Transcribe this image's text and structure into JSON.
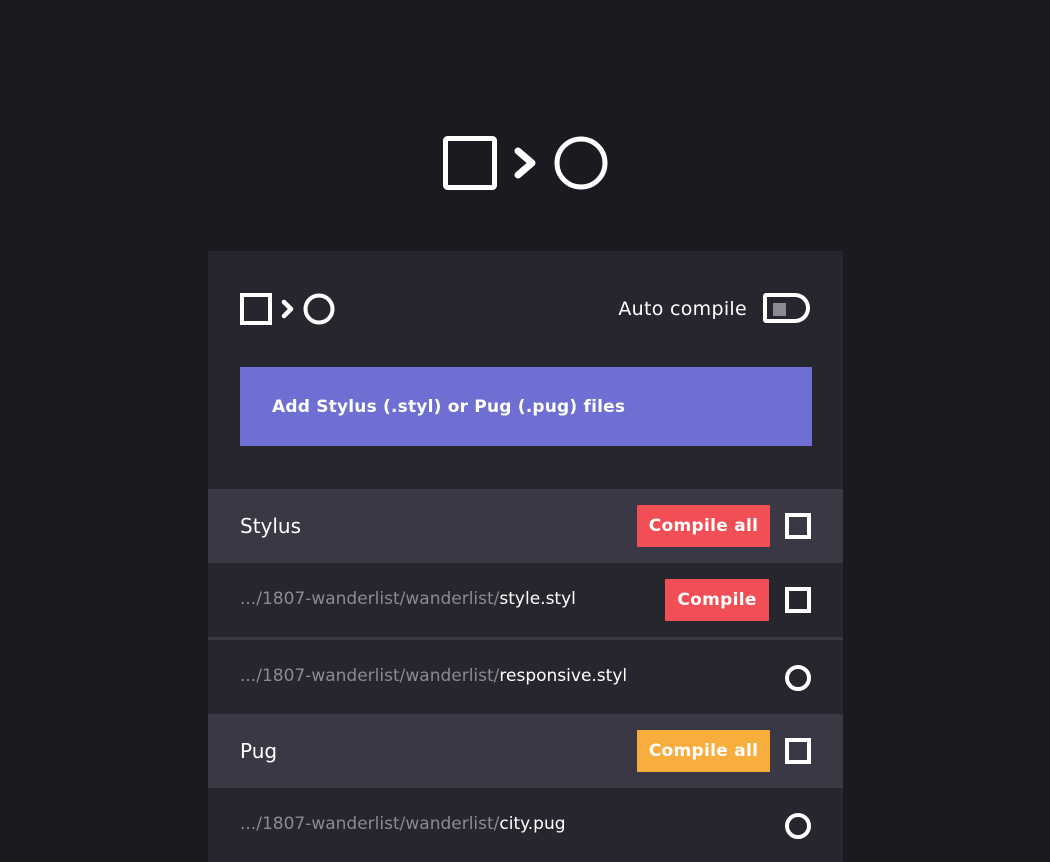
{
  "header": {
    "auto_compile_label": "Auto compile"
  },
  "add_files": {
    "label": "Add Stylus (.styl) or Pug (.pug) files"
  },
  "groups": [
    {
      "title": "Stylus",
      "action_label": "Compile all",
      "action_color": "#f14f55",
      "files": [
        {
          "dir": ".../1807-wanderlist/wanderlist/",
          "name": "style.styl",
          "action_label": "Compile",
          "status": "checkbox"
        },
        {
          "dir": ".../1807-wanderlist/wanderlist/",
          "name": "responsive.styl",
          "status": "circle"
        }
      ]
    },
    {
      "title": "Pug",
      "action_label": "Compile all",
      "action_color": "#f7ae3d",
      "files": [
        {
          "dir": ".../1807-wanderlist/wanderlist/",
          "name": "city.pug",
          "status": "circle"
        }
      ]
    }
  ],
  "icons": {
    "logo": [
      "square-icon",
      "chevron-right-icon",
      "circle-icon"
    ],
    "toggle": "toggle-switch"
  },
  "colors": {
    "background": "#1b1a21",
    "panel": "#26262f",
    "group_header": "#393844",
    "accent": "#6f6ed3",
    "compile_red": "#f14f55",
    "compile_yellow": "#f7ae3d"
  }
}
